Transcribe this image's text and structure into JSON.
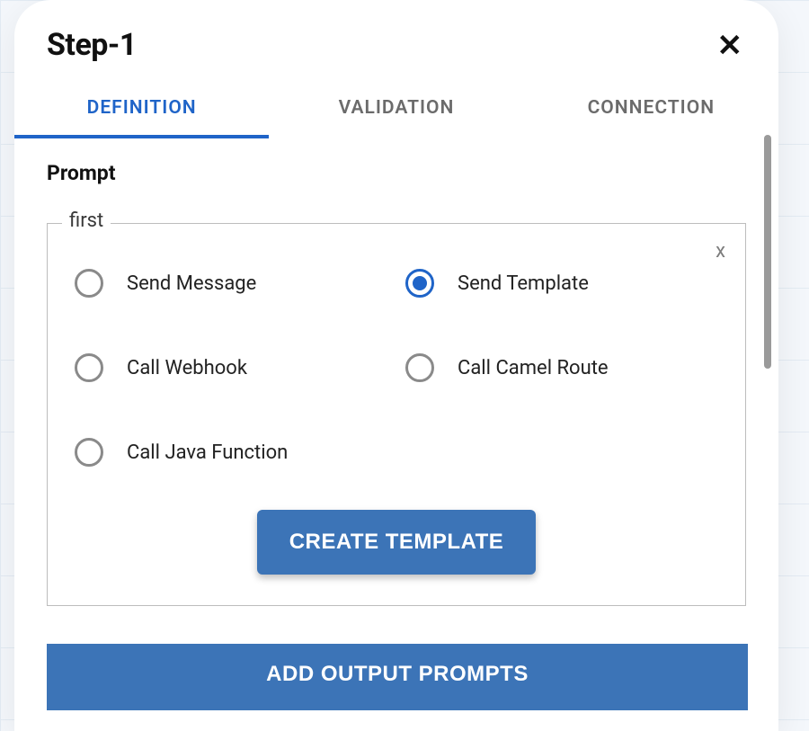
{
  "header": {
    "title": "Step-1"
  },
  "tabs": [
    {
      "label": "DEFINITION",
      "active": true
    },
    {
      "label": "VALIDATION",
      "active": false
    },
    {
      "label": "CONNECTION",
      "active": false
    }
  ],
  "section": {
    "label": "Prompt",
    "fieldset_legend": "first",
    "fieldset_close": "x"
  },
  "radios": [
    {
      "label": "Send Message",
      "selected": false
    },
    {
      "label": "Send Template",
      "selected": true
    },
    {
      "label": "Call Webhook",
      "selected": false
    },
    {
      "label": "Call Camel Route",
      "selected": false
    },
    {
      "label": "Call Java Function",
      "selected": false
    }
  ],
  "buttons": {
    "create_template": "CREATE TEMPLATE",
    "add_output": "ADD OUTPUT PROMPTS"
  },
  "icons": {
    "close": "✕"
  },
  "colors": {
    "primary": "#1f64c8",
    "button_bg": "#3c74b7"
  }
}
